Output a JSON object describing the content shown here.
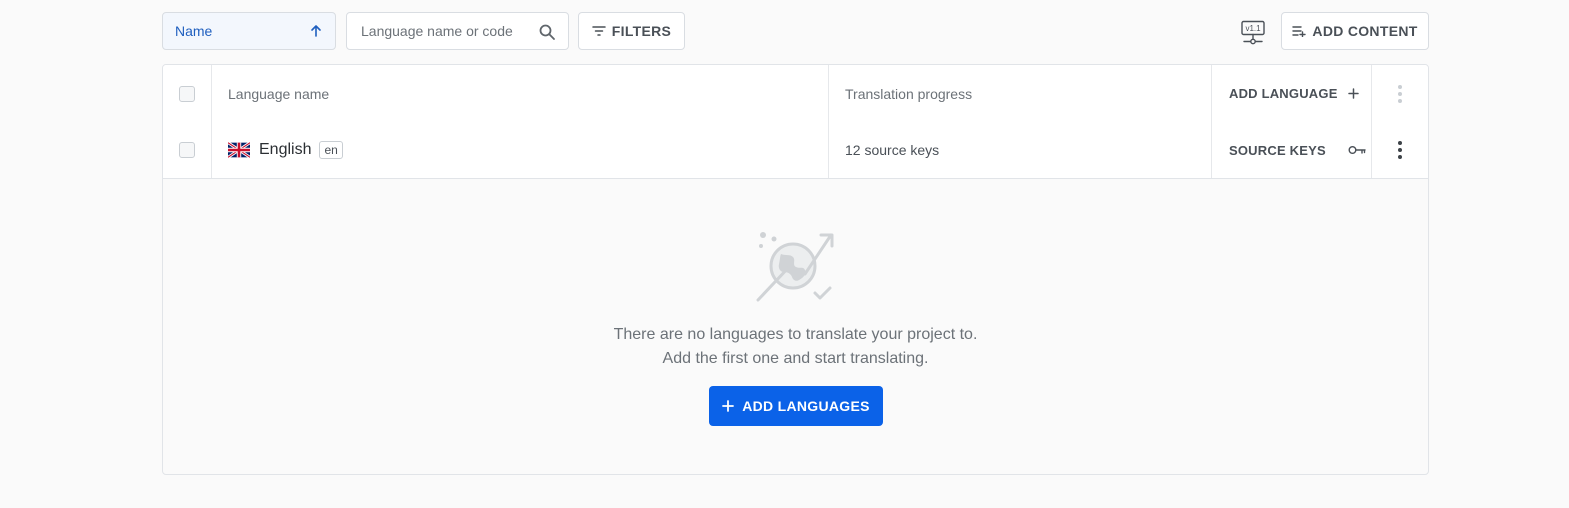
{
  "toolbar": {
    "sort_label": "Name",
    "search_placeholder": "Language name or code",
    "filters_label": "FILTERS",
    "version_icon_text": "v1.1",
    "add_content_label": "ADD CONTENT"
  },
  "table": {
    "columns": {
      "name": "Language name",
      "progress": "Translation progress",
      "add_language": "ADD LANGUAGE"
    },
    "rows": [
      {
        "name": "English",
        "code": "en",
        "progress": "12 source keys",
        "action": "SOURCE KEYS",
        "flag": "uk-flag-icon"
      }
    ]
  },
  "empty_state": {
    "line1": "There are no languages to translate your project to.",
    "line2": "Add the first one and start translating.",
    "button_label": "ADD LANGUAGES"
  },
  "colors": {
    "accent": "#0b62e8",
    "sort_text": "#1f5fbf",
    "border": "#d9dde2"
  }
}
